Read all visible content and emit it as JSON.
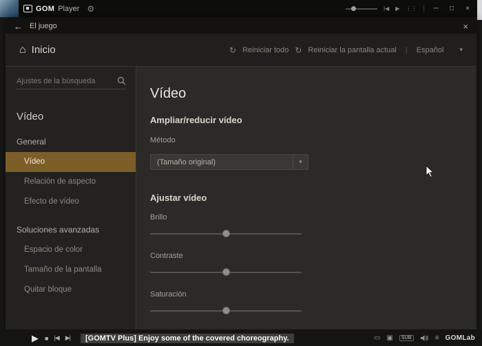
{
  "player": {
    "titlebar": {
      "logo_gom": "GOM",
      "logo_player": "Player"
    },
    "bottombar": {
      "marquee": "[GOMTV Plus] Enjoy some of the covered choreography.",
      "sub_label": "SUB",
      "gomlab_label": "GOMLab"
    }
  },
  "dialog": {
    "titlebar": {
      "back_label": "El juego"
    },
    "header": {
      "title": "Inicio",
      "reset_all_label": "Reiniciar todo",
      "reset_screen_label": "Reiniciar la pantalla actual",
      "separator": "|",
      "language_label": "Español"
    },
    "sidebar": {
      "search_placeholder": "Ajustes de la búsqueda",
      "section_title": "Vídeo",
      "groups": [
        {
          "label": "General",
          "items": [
            {
              "label": "Vídeo",
              "selected": true
            },
            {
              "label": "Relación de aspecto",
              "selected": false
            },
            {
              "label": "Efecto de vídeo",
              "selected": false
            }
          ]
        },
        {
          "label": "Soluciones avanzadas",
          "items": [
            {
              "label": "Espacio de color",
              "selected": false
            },
            {
              "label": "Tamaño de la pantalla",
              "selected": false
            },
            {
              "label": "Quitar bloque",
              "selected": false
            }
          ]
        }
      ]
    },
    "content": {
      "title": "Vídeo",
      "zoom_section_title": "Ampliar/reducir vídeo",
      "method_label": "Método",
      "method_value": "(Tamaño original)",
      "adjust_section_title": "Ajustar vídeo",
      "sliders": [
        {
          "label": "Brillo",
          "value": 50
        },
        {
          "label": "Contraste",
          "value": 50
        },
        {
          "label": "Saturación",
          "value": 50
        }
      ]
    }
  },
  "icons": {
    "back": "←",
    "close": "×",
    "home": "⌂",
    "gear": "⚙",
    "reset": "↻",
    "chevron_down": "▾",
    "minimize": "─",
    "maximize": "□",
    "play": "▶",
    "stop": "■",
    "prev": "|◀",
    "next": "▶|",
    "grid": "⋮⋮",
    "playlist": "≡",
    "square": "▣",
    "rect": "▭"
  },
  "colors": {
    "accent": "#7c5e28",
    "selected_text": "#f2e9d2"
  }
}
